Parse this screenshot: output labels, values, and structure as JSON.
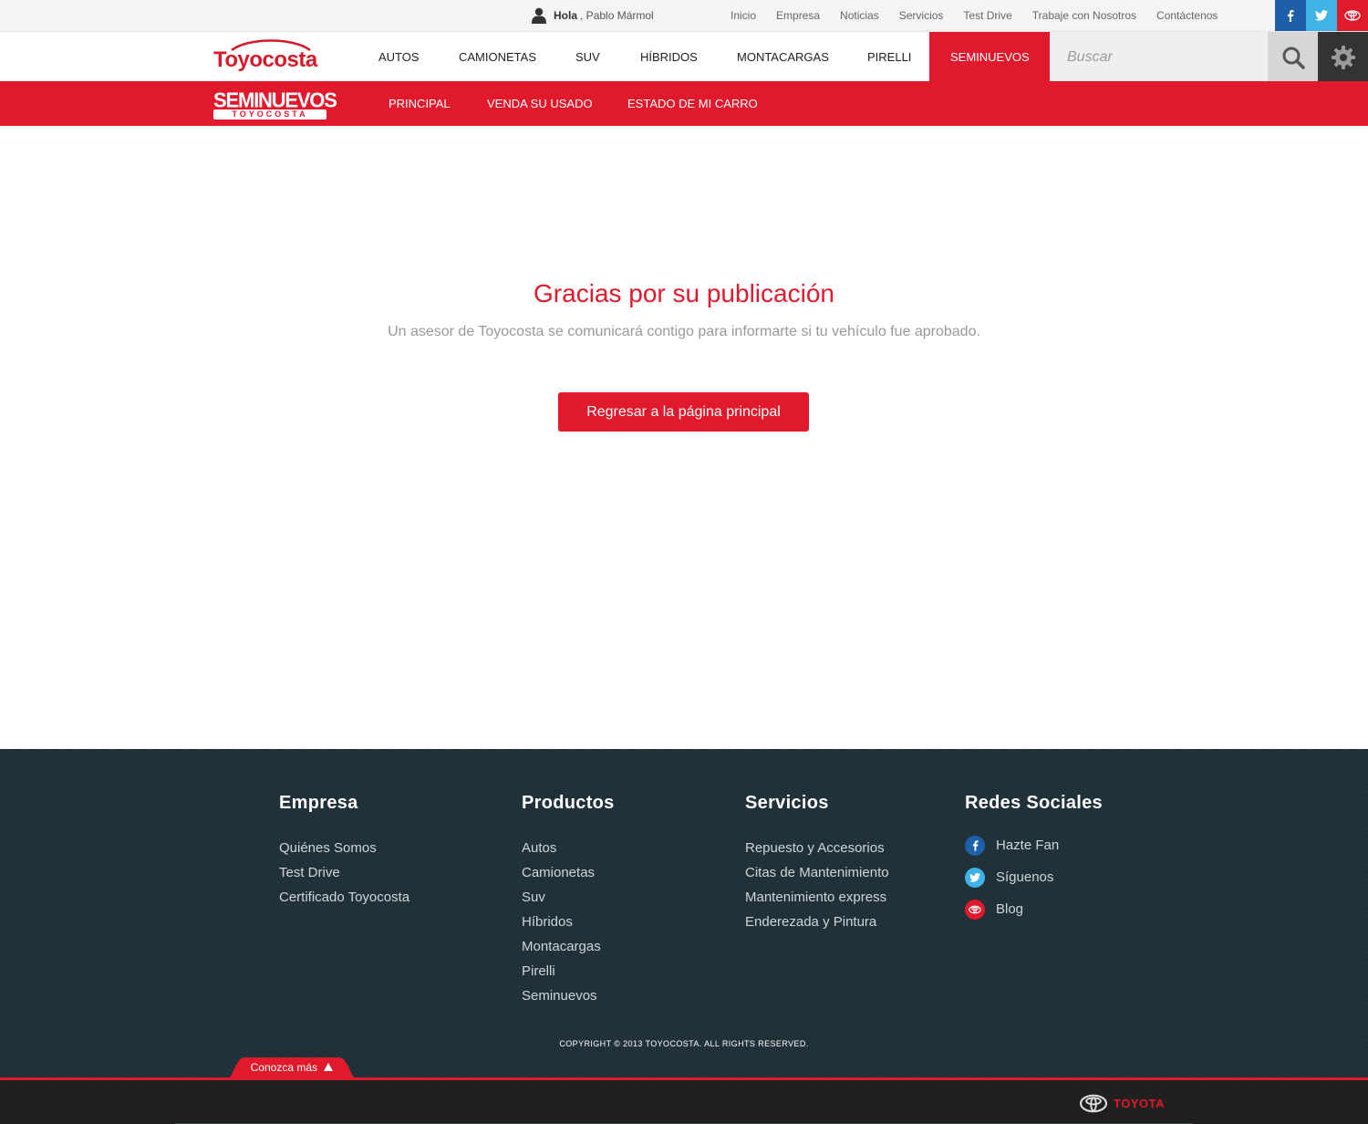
{
  "topbar": {
    "greeting_hola": "Hola",
    "greeting_name": ", Pablo Mármol",
    "links": [
      "Inicio",
      "Empresa",
      "Noticias",
      "Servicios",
      "Test Drive",
      "Trabaje con Nosotros",
      "Contáctenos"
    ],
    "colors": {
      "facebook": "#1d5fa8",
      "twitter": "#3fb2e8",
      "toyota": "#e01a2c"
    }
  },
  "mainnav": {
    "logo": "Toyocosta",
    "items": [
      "AUTOS",
      "CAMIONETAS",
      "SUV",
      "HÍBRIDOS",
      "MONTACARGAS",
      "PIRELLI",
      "SEMINUEVOS"
    ],
    "active": "SEMINUEVOS",
    "search_placeholder": "Buscar"
  },
  "subnav": {
    "logo_main": "SEMINUEVOS",
    "logo_sub": "TOYOCOSTA",
    "items": [
      "PRINCIPAL",
      "VENDA SU USADO",
      "ESTADO DE MI CARRO"
    ]
  },
  "content": {
    "title": "Gracias por su publicación",
    "message": "Un asesor de Toyocosta se comunicará contigo para informarte si tu vehículo fue aprobado.",
    "button": "Regresar a la página principal"
  },
  "footer": {
    "empresa": {
      "title": "Empresa",
      "items": [
        "Quiénes Somos",
        "Test Drive",
        "Certificado Toyocosta"
      ]
    },
    "productos": {
      "title": "Productos",
      "items": [
        "Autos",
        "Camionetas",
        "Suv",
        "Híbridos",
        "Montacargas",
        "Pirelli",
        "Seminuevos"
      ]
    },
    "servicios": {
      "title": "Servicios",
      "items": [
        "Repuesto y Accesorios",
        "Citas de Mantenimiento",
        "Mantenimiento express",
        "Enderezada y Pintura"
      ]
    },
    "redes": {
      "title": "Redes Sociales",
      "items": [
        "Hazte Fan",
        "Síguenos",
        "Blog"
      ]
    },
    "copyright": "COPYRIGHT © 2013 TOYOCOSTA. ALL RIGHTS RESERVED.",
    "conozca": "Conozca más",
    "brand": "TOYOTA"
  },
  "colors": {
    "accent": "#e01a2c",
    "footer_bg": "#1f3038"
  }
}
